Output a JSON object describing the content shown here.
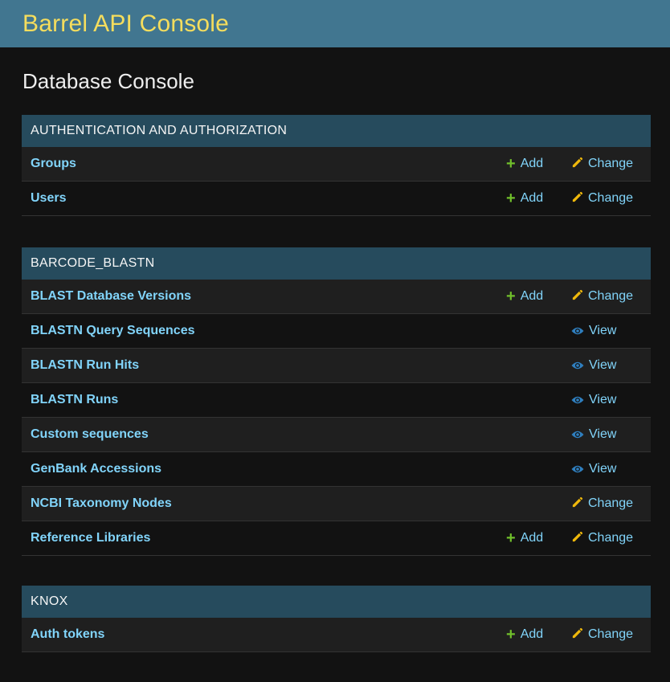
{
  "header": {
    "site_title": "Barrel API Console"
  },
  "page": {
    "title": "Database Console"
  },
  "icons": {
    "add": "plus-icon",
    "change": "pencil-icon",
    "view": "eye-icon"
  },
  "colors": {
    "header_bg": "#417690",
    "title": "#f5dd5d",
    "caption_bg": "#264b5d",
    "link": "#81d4fa",
    "add_icon": "#70bf2b",
    "change_icon": "#efb80b",
    "view_icon": "#2f7fbf"
  },
  "labels": {
    "add": "Add",
    "change": "Change",
    "view": "View"
  },
  "modules": [
    {
      "caption": "AUTHENTICATION AND AUTHORIZATION",
      "rows": [
        {
          "label": "Groups",
          "add": true,
          "change": true,
          "view": false
        },
        {
          "label": "Users",
          "add": true,
          "change": true,
          "view": false
        }
      ]
    },
    {
      "caption": "BARCODE_BLASTN",
      "rows": [
        {
          "label": "BLAST Database Versions",
          "add": true,
          "change": true,
          "view": false
        },
        {
          "label": "BLASTN Query Sequences",
          "add": false,
          "change": false,
          "view": true
        },
        {
          "label": "BLASTN Run Hits",
          "add": false,
          "change": false,
          "view": true
        },
        {
          "label": "BLASTN Runs",
          "add": false,
          "change": false,
          "view": true
        },
        {
          "label": "Custom sequences",
          "add": false,
          "change": false,
          "view": true
        },
        {
          "label": "GenBank Accessions",
          "add": false,
          "change": false,
          "view": true
        },
        {
          "label": "NCBI Taxonomy Nodes",
          "add": false,
          "change": true,
          "view": false
        },
        {
          "label": "Reference Libraries",
          "add": true,
          "change": true,
          "view": false
        }
      ]
    },
    {
      "caption": "KNOX",
      "rows": [
        {
          "label": "Auth tokens",
          "add": true,
          "change": true,
          "view": false
        }
      ]
    }
  ]
}
